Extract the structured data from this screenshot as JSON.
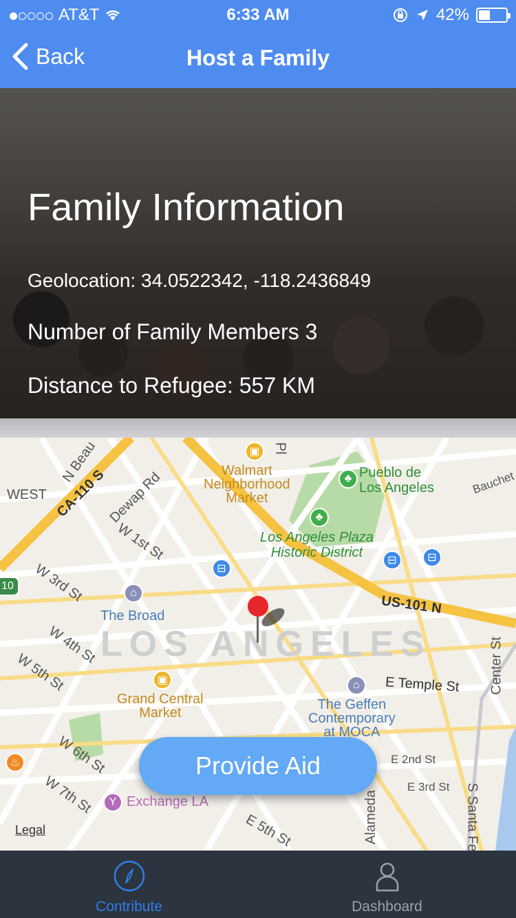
{
  "status_bar": {
    "carrier": "AT&T",
    "time": "6:33 AM",
    "battery": "42%",
    "signal_dots": 1
  },
  "nav": {
    "back_label": "Back",
    "title": "Host a Family"
  },
  "family": {
    "heading": "Family Information",
    "geolocation": "Geolocation: 34.0522342, -118.2436849",
    "members": "Number of Family Members 3",
    "distance": "Distance to Refugee: 557 KM"
  },
  "map": {
    "labels": {
      "west": "WEST",
      "n_beaudry": "N Beau",
      "ca110": "CA-110 S",
      "dewap": "Dewap Rd",
      "w1st": "W 1st St",
      "w3rd": "W 3rd St",
      "w4th": "W 4th St",
      "w5th": "W 5th St",
      "w6th": "W 6th St",
      "w7th": "W 7th St",
      "pl": "Pl",
      "walmart": "Walmart\nNeighborhood\nMarket",
      "pueblo": "Pueblo de\nLos Angeles",
      "bauchet": "Bauchet",
      "plaza": "Los Angeles Plaza\nHistoric District",
      "us101": "US-101 N",
      "broad": "The Broad",
      "los_angeles": "LOS ANGELES",
      "e_temple": "E Temple St",
      "center": "Center St",
      "grand_central": "Grand Central\nMarket",
      "geffen": "The Geffen\nContemporary\nat MOCA",
      "e2nd": "E 2nd St",
      "e3rd": "E 3rd St",
      "exchange": "Exchange LA",
      "alameda": "Alameda",
      "e5th": "E 5th St",
      "s_santa_fe": "S Santa Fe",
      "shield_10": "10",
      "legal": "Legal"
    },
    "provide_aid_label": "Provide Aid"
  },
  "tabs": [
    {
      "label": "Contribute",
      "icon": "compass-icon",
      "active": true
    },
    {
      "label": "Dashboard",
      "icon": "person-icon",
      "active": false
    }
  ],
  "colors": {
    "nav": "#4f8cf0",
    "accent": "#2d7fe6",
    "tabbar": "#2c3440",
    "button": "#63a9f5"
  }
}
